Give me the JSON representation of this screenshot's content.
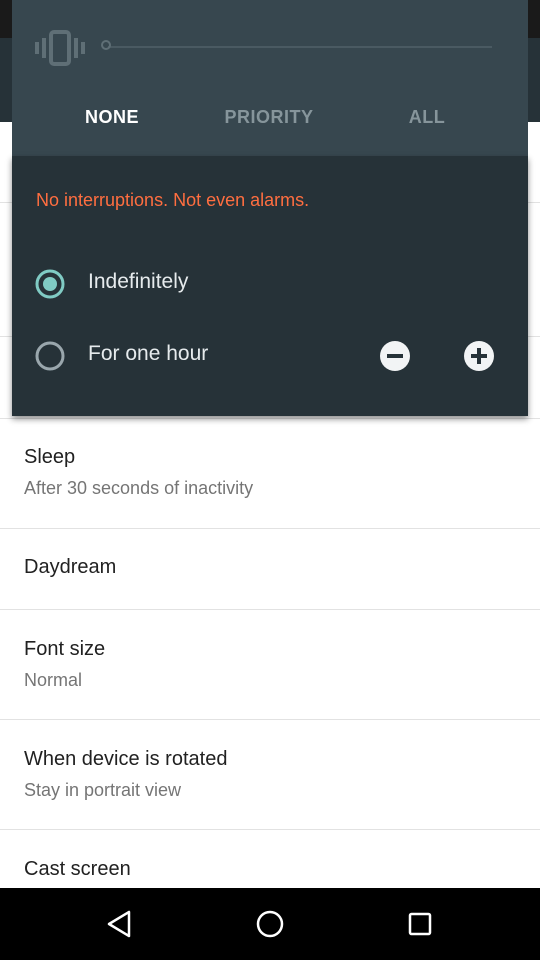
{
  "interruptions_panel": {
    "tabs": [
      {
        "label": "NONE",
        "selected": true
      },
      {
        "label": "PRIORITY",
        "selected": false
      },
      {
        "label": "ALL",
        "selected": false
      }
    ],
    "description": "No interruptions. Not even alarms.",
    "options": [
      {
        "label": "Indefinitely",
        "selected": true
      },
      {
        "label": "For one hour",
        "selected": false
      }
    ],
    "accent_color": "#80cbc4",
    "description_color": "#ff6e40"
  },
  "settings": {
    "sleep": {
      "title": "Sleep",
      "summary": "After 30 seconds of inactivity"
    },
    "daydream": {
      "title": "Daydream"
    },
    "font_size": {
      "title": "Font size",
      "summary": "Normal"
    },
    "rotation": {
      "title": "When device is rotated",
      "summary": "Stay in portrait view"
    },
    "cast": {
      "title": "Cast screen"
    }
  },
  "icons": {
    "vibrate": "vibrate-icon",
    "minus": "minus-circle-icon",
    "plus": "plus-circle-icon",
    "back": "back-triangle-icon",
    "home": "home-circle-icon",
    "recents": "recents-square-icon"
  }
}
